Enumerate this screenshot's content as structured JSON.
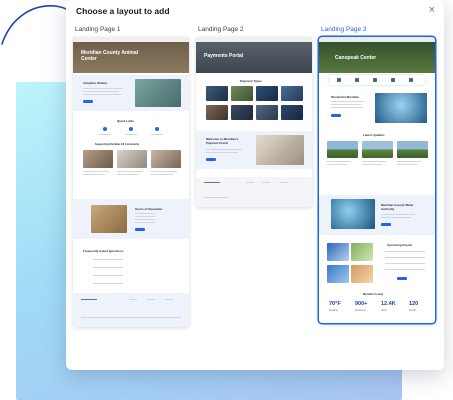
{
  "modal": {
    "title": "Choose a layout to add",
    "close_symbol": "×"
  },
  "layouts": [
    {
      "label": "Landing Page 1",
      "hero_text": "Meridian County Animal Center",
      "selected": false
    },
    {
      "label": "Landing Page 2",
      "hero_text": "Payments Portal",
      "selected": false
    },
    {
      "label": "Landing Page 3",
      "hero_text": "Canopeak Center",
      "selected": true
    }
  ],
  "thumb1": {
    "section_about": "Adoption Shelter",
    "section_quick": "Quick Links",
    "section_stories": "Supporting Meridian All Community",
    "section_hours": "Hours of Operation",
    "section_faq": "Frequently Asked Questions"
  },
  "thumb2": {
    "section_types": "Payment Types",
    "welcome": "Welcome to Meridian's Payment Portal"
  },
  "thumb3": {
    "welcome": "Wonderful Meridian",
    "section_updates": "Latest Updates",
    "water_title": "Meridian County Water Authority",
    "events": "Upcoming Events",
    "stats_title": "Meridian County",
    "stats": [
      {
        "value": "70°F",
        "label": "Weather"
      },
      {
        "value": "900+",
        "label": "Residents"
      },
      {
        "value": "12.4K",
        "label": "Visits"
      },
      {
        "value": "120",
        "label": "Events"
      }
    ]
  },
  "colors": {
    "accent": "#2563eb",
    "selected_label": "#2563eb"
  }
}
